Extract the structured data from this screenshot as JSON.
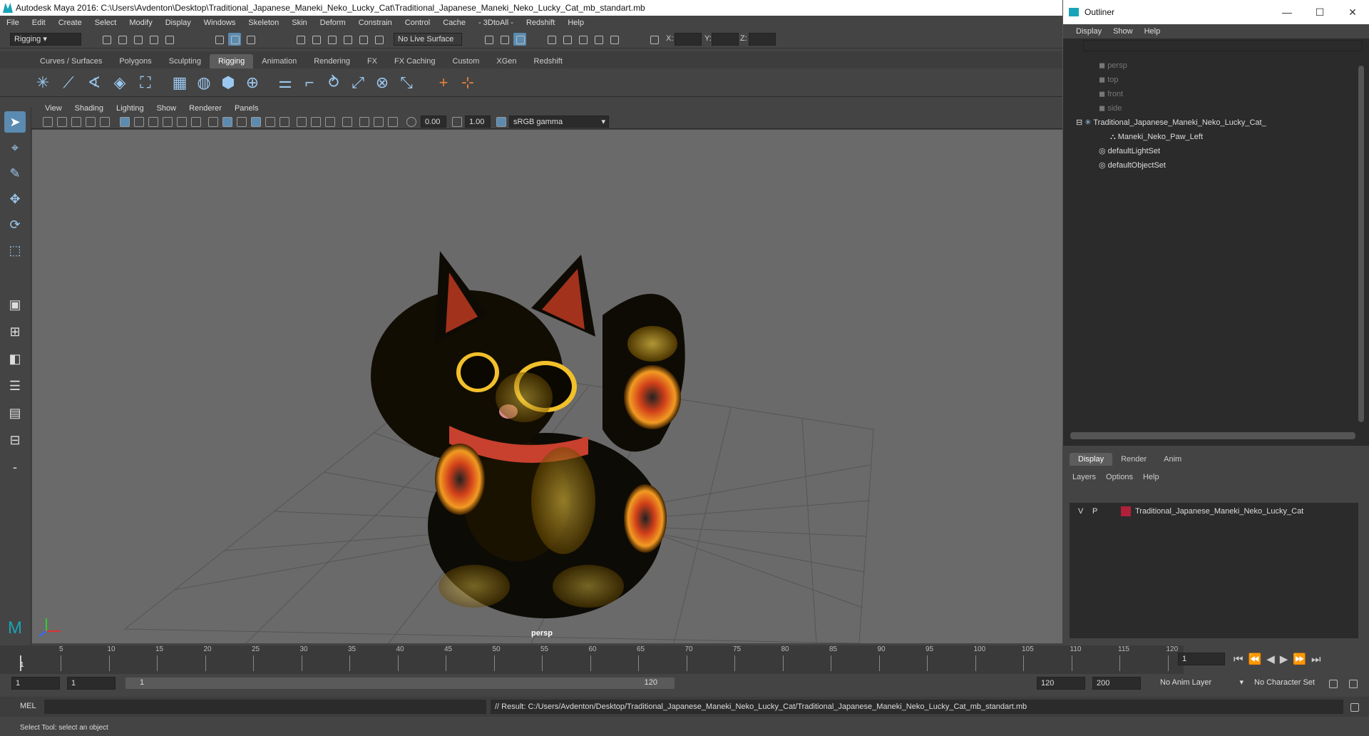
{
  "title": "Autodesk Maya 2016: C:\\Users\\Avdenton\\Desktop\\Traditional_Japanese_Maneki_Neko_Lucky_Cat\\Traditional_Japanese_Maneki_Neko_Lucky_Cat_mb_standart.mb",
  "menu": [
    "File",
    "Edit",
    "Create",
    "Select",
    "Modify",
    "Display",
    "Windows",
    "Skeleton",
    "Skin",
    "Deform",
    "Constrain",
    "Control",
    "Cache",
    "- 3DtoAll -",
    "Redshift",
    "Help"
  ],
  "status": {
    "mode": "Rigging",
    "live_surface": "No Live Surface",
    "x_label": "X:",
    "y_label": "Y:",
    "z_label": "Z:"
  },
  "shelf_tabs": [
    "Curves / Surfaces",
    "Polygons",
    "Sculpting",
    "Rigging",
    "Animation",
    "Rendering",
    "FX",
    "FX Caching",
    "Custom",
    "XGen",
    "Redshift"
  ],
  "active_shelf": "Rigging",
  "panel_menu": [
    "View",
    "Shading",
    "Lighting",
    "Show",
    "Renderer",
    "Panels"
  ],
  "panel_tools": {
    "exposure": "0.00",
    "gamma": "1.00",
    "colorspace": "sRGB gamma"
  },
  "viewport": {
    "camera": "persp"
  },
  "timeline": {
    "ticks": [
      "5",
      "10",
      "15",
      "20",
      "25",
      "30",
      "35",
      "40",
      "45",
      "50",
      "55",
      "60",
      "65",
      "70",
      "75",
      "80",
      "85",
      "90",
      "95",
      "100",
      "105",
      "110",
      "115",
      "120"
    ],
    "first": "1",
    "current_frame": "1"
  },
  "range": {
    "start": "1",
    "start2": "1",
    "slider_start": "1",
    "slider_end": "120",
    "end": "120",
    "end2": "200",
    "anim_layer": "No Anim Layer",
    "char_set": "No Character Set"
  },
  "cmd": {
    "label": "MEL",
    "result": "// Result: C:/Users/Avdenton/Desktop/Traditional_Japanese_Maneki_Neko_Lucky_Cat/Traditional_Japanese_Maneki_Neko_Lucky_Cat_mb_standart.mb"
  },
  "help": "Select Tool: select an object",
  "outliner": {
    "title": "Outliner",
    "menu": [
      "Display",
      "Show",
      "Help"
    ],
    "items": [
      "persp",
      "top",
      "front",
      "side",
      "Traditional_Japanese_Maneki_Neko_Lucky_Cat_",
      "Maneki_Neko_Paw_Left",
      "defaultLightSet",
      "defaultObjectSet"
    ]
  },
  "layers": {
    "tabs": [
      "Display",
      "Render",
      "Anim"
    ],
    "menu": [
      "Layers",
      "Options",
      "Help"
    ],
    "row": {
      "v": "V",
      "p": "P",
      "name": "Traditional_Japanese_Maneki_Neko_Lucky_Cat",
      "color": "#b0203a"
    }
  }
}
